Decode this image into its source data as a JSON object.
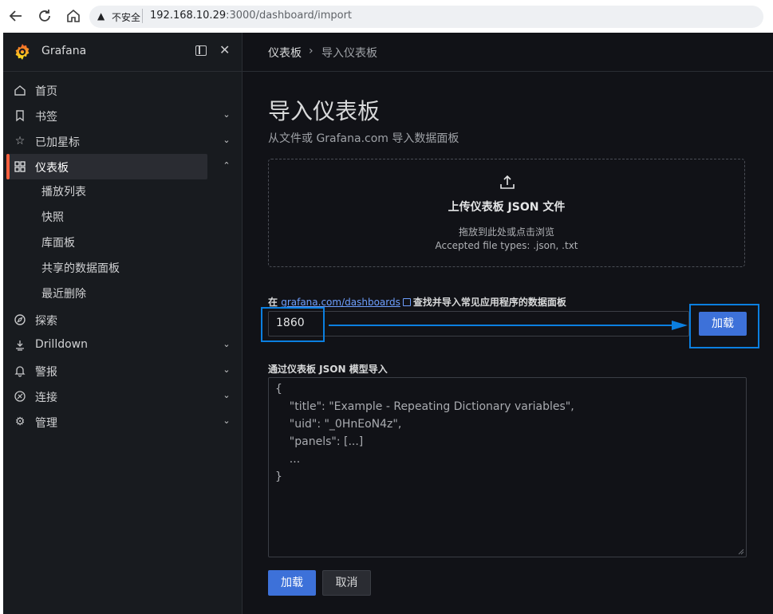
{
  "browser": {
    "back_icon": "back-arrow-icon",
    "reload_icon": "reload-icon",
    "home_icon": "home-icon",
    "security_warning": "不安全",
    "url_host": "192.168.10.29",
    "url_rest": ":3000/dashboard/import"
  },
  "sidebar": {
    "brand": "Grafana",
    "items": [
      {
        "label": "首页",
        "icon": "home-icon"
      },
      {
        "label": "书签",
        "icon": "bookmark-icon"
      },
      {
        "label": "已加星标",
        "icon": "star-icon"
      },
      {
        "label": "仪表板",
        "icon": "apps-icon"
      },
      {
        "label": "探索",
        "icon": "compass-icon"
      },
      {
        "label": "Drilldown",
        "icon": "drilldown-icon"
      },
      {
        "label": "警报",
        "icon": "bell-icon"
      },
      {
        "label": "连接",
        "icon": "link-icon"
      },
      {
        "label": "管理",
        "icon": "gear-icon"
      }
    ],
    "dashboards_children": [
      "播放列表",
      "快照",
      "库面板",
      "共享的数据面板",
      "最近删除"
    ]
  },
  "breadcrumb": {
    "parent": "仪表板",
    "separator": "›",
    "current": "导入仪表板"
  },
  "page": {
    "title": "导入仪表板",
    "subtitle": "从文件或 Grafana.com 导入数据面板"
  },
  "upload": {
    "title": "上传仪表板 JSON 文件",
    "hint": "拖放到此处或点击浏览",
    "accepted": "Accepted file types: .json, .txt"
  },
  "grafana_com": {
    "prefix": "在",
    "link": "grafana.com/dashboards",
    "suffix": "查找并导入常见应用程序的数据面板",
    "input_value": "1860",
    "load_button": "加载"
  },
  "json_model": {
    "label": "通过仪表板 JSON 模型导入",
    "lines": [
      "{",
      "    \"title\": \"Example - Repeating Dictionary variables\",",
      "    \"uid\": \"_0HnEoN4z\",",
      "    \"panels\": [...]",
      "    ...",
      "}"
    ]
  },
  "actions": {
    "load": "加载",
    "cancel": "取消"
  },
  "colors": {
    "accent": "#3d71d9",
    "active_marker": "#f55f3e",
    "annotation": "#0b7fe0"
  }
}
